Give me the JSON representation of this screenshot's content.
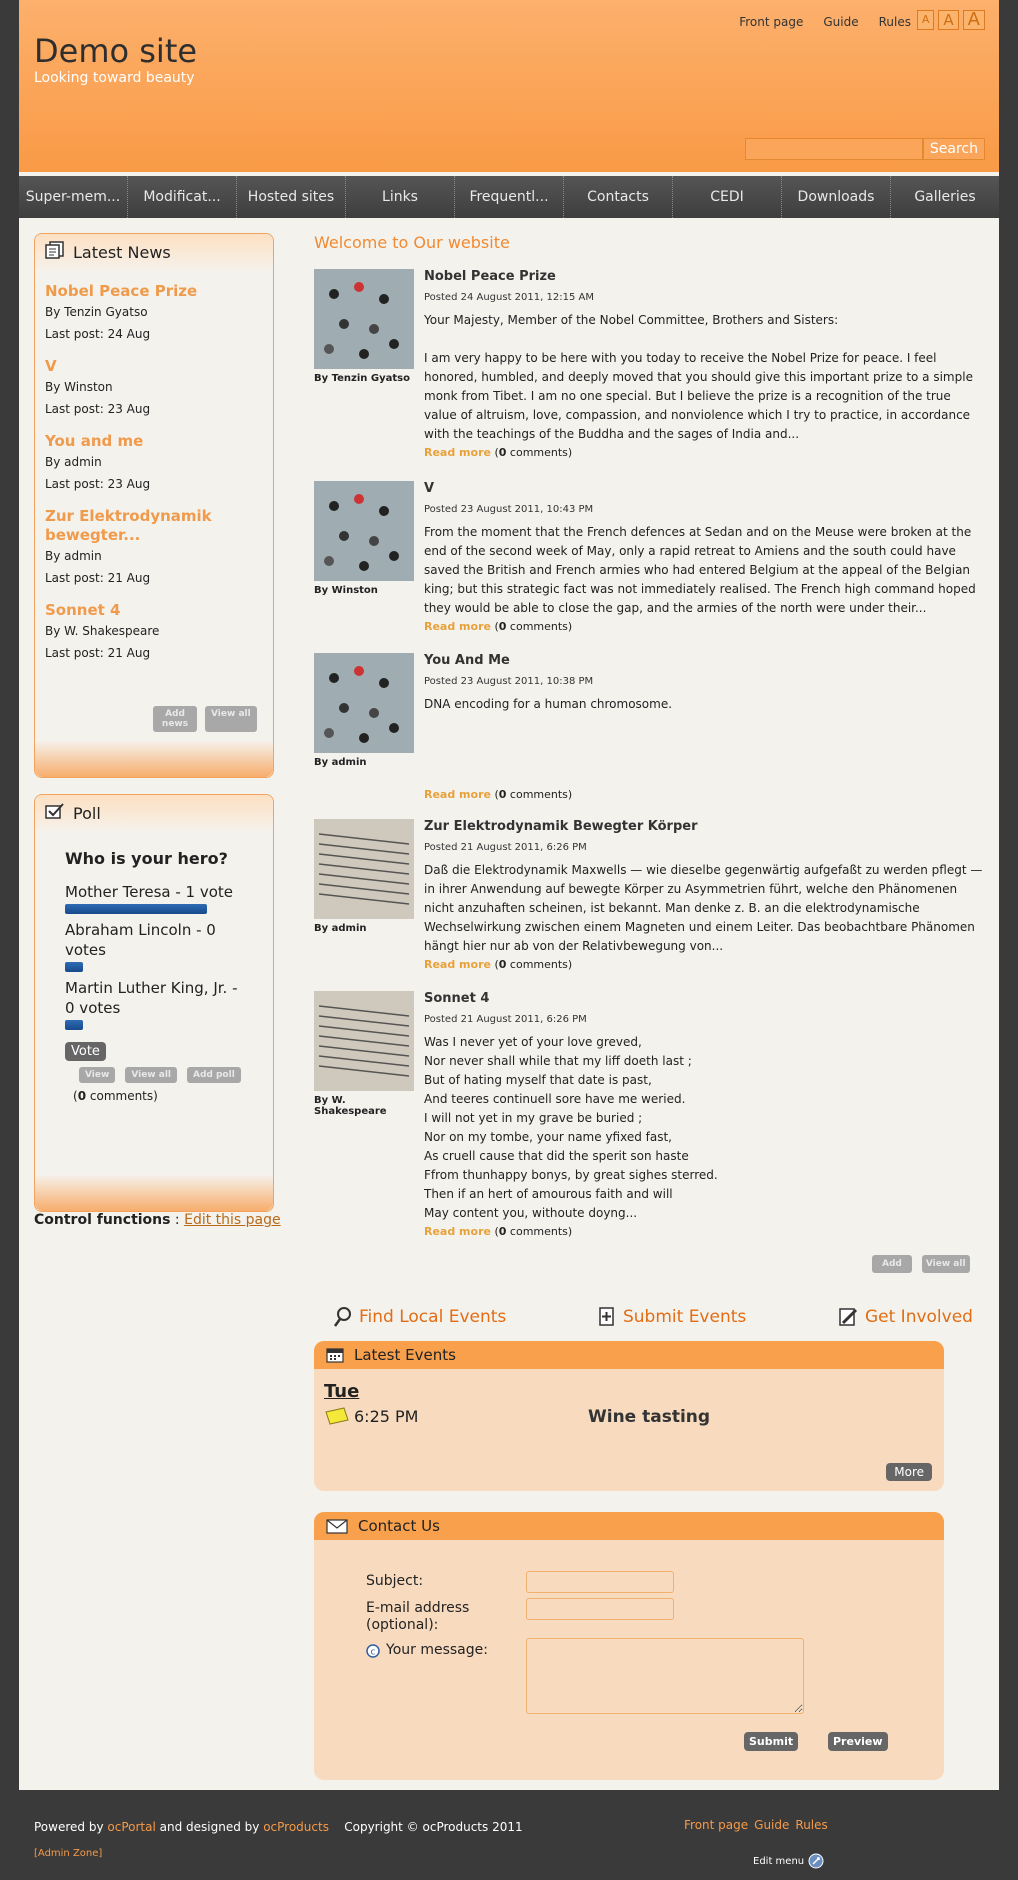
{
  "header": {
    "site_title": "Demo site",
    "tagline": "Looking toward beauty",
    "top_links": [
      "Front page",
      "Guide",
      "Rules"
    ],
    "font_sizes": [
      "A",
      "A",
      "A"
    ],
    "search_button": "Search"
  },
  "nav": [
    "Super-mem...",
    "Modificat...",
    "Hosted sites",
    "Links",
    "Frequentl...",
    "Contacts",
    "CEDI",
    "Downloads",
    "Galleries"
  ],
  "latest_news": {
    "title": "Latest News",
    "items": [
      {
        "title": "Nobel Peace Prize",
        "by": "By Tenzin Gyatso",
        "last": "Last post: 24 Aug"
      },
      {
        "title": "V",
        "by": "By Winston",
        "last": "Last post: 23 Aug"
      },
      {
        "title": "You and me",
        "by": "By admin",
        "last": "Last post: 23 Aug"
      },
      {
        "title": "Zur Elektrodynamik bewegter...",
        "by": "By admin",
        "last": "Last post: 21 Aug"
      },
      {
        "title": "Sonnet 4",
        "by": "By W. Shakespeare",
        "last": "Last post: 21 Aug"
      }
    ],
    "add_btn": "Add news",
    "view_all_btn": "View all"
  },
  "poll": {
    "title": "Poll",
    "question": "Who is your hero?",
    "options": [
      {
        "label": "Mother Teresa - 1 vote",
        "fraction": 1.0
      },
      {
        "label": "Abraham Lincoln - 0 votes",
        "fraction": 0.0
      },
      {
        "label": "Martin Luther King, Jr. - 0 votes",
        "fraction": 0.0
      }
    ],
    "vote_btn": "Vote",
    "view_btn": "View",
    "view_all_btn": "View all",
    "add_poll_btn": "Add poll",
    "comments_count": "0",
    "comments_label": "comments"
  },
  "control": {
    "label": "Control functions",
    "sep": " : ",
    "link": "Edit this page"
  },
  "welcome": "Welcome to Our website",
  "posts": [
    {
      "title": "Nobel Peace Prize",
      "date": "Posted 24 August 2011, 12:15 AM",
      "by": "By Tenzin Gyatso",
      "text": "Your Majesty, Member of the Nobel Committee, Brothers and Sisters:\n\nI am very happy to be here with you today to receive the Nobel Prize for peace. I feel honored, humbled, and deeply moved that you should give this important prize to a simple monk from Tibet. I am no one special. But I believe the prize is a recognition of the true value of altruism, love, compassion, and nonviolence which I try to practice, in accordance with the teachings of the Buddha and the sages of India and...",
      "read_more": "Read more",
      "comments_count": "0",
      "comments_label": "comments"
    },
    {
      "title": "V",
      "date": "Posted 23 August 2011, 10:43 PM",
      "by": "By Winston",
      "text": "From the moment that the French defences at Sedan and on the Meuse were broken at the end of the second week of May, only a rapid retreat to Amiens and the south could have saved the British and French armies who had entered Belgium at the appeal of the Belgian king; but this strategic fact was not immediately realised. The French high command hoped they would be able to close the gap, and the armies of the north were under their...",
      "read_more": "Read more",
      "comments_count": "0",
      "comments_label": "comments"
    },
    {
      "title": "You And Me",
      "date": "Posted 23 August 2011, 10:38 PM",
      "by": "By admin",
      "text": "DNA encoding for a human chromosome.",
      "read_more": "Read more",
      "comments_count": "0",
      "comments_label": "comments"
    },
    {
      "title": "Zur Elektrodynamik Bewegter Körper",
      "date": "Posted 21 August 2011, 6:26 PM",
      "by": "By admin",
      "text": "Daß die Elektrodynamik Maxwells — wie dieselbe gegenwärtig aufgefaßt zu werden pflegt — in ihrer Anwendung auf bewegte Körper zu Asymmetrien führt, welche den Phänomenen nicht anzuhaften scheinen, ist bekannt. Man denke z. B. an die elektrodynamische Wechselwirkung zwischen einem Magneten und einem Leiter. Das beobachtbare Phänomen hängt hier nur ab von der Relativbewegung von...",
      "read_more": "Read more",
      "comments_count": "0",
      "comments_label": "comments"
    },
    {
      "title": "Sonnet 4",
      "date": "Posted 21 August 2011, 6:26 PM",
      "by": "By W. Shakespeare",
      "text": "Was I never yet of your love greved,\nNor never shall while that my liff doeth last ;\nBut of hating myself that date is past,\nAnd teeres continuell sore have me weried.\nI will not yet in my grave be buried ;\nNor on my tombe, your name yfixed fast,\nAs cruell cause that did the sperit son haste\nFfrom thunhappy bonys, by great sighes sterred.\nThen if an hert of amourous faith and will\nMay content you, withoute doyng...",
      "read_more": "Read more",
      "comments_count": "0",
      "comments_label": "comments"
    }
  ],
  "posts_actions": {
    "add": "Add",
    "view_all": "View all"
  },
  "events_links": {
    "find": "Find Local Events",
    "submit": "Submit Events",
    "involved": "Get Involved"
  },
  "latest_events": {
    "title": "Latest Events",
    "day": "Tue",
    "time": "6:25 PM",
    "event": "Wine tasting",
    "more_btn": "More"
  },
  "contact": {
    "title": "Contact Us",
    "subject_label": "Subject:",
    "email_label": "E-mail address (optional):",
    "message_label": "Your message:",
    "submit_btn": "Submit",
    "preview_btn": "Preview"
  },
  "footer": {
    "powered": "Powered by",
    "ocportal": "ocPortal",
    "designed": "and designed by",
    "ocproducts": "ocProducts",
    "copyright": "Copyright © ocProducts 2011",
    "admin_zone": "[Admin Zone]",
    "links": [
      "Front page",
      "Guide",
      "Rules"
    ],
    "edit_menu": "Edit menu"
  },
  "colors": {
    "accent": "#f99a46",
    "link": "#f09a4c",
    "nav": "#444444",
    "page_bg": "#f4f2ed"
  }
}
